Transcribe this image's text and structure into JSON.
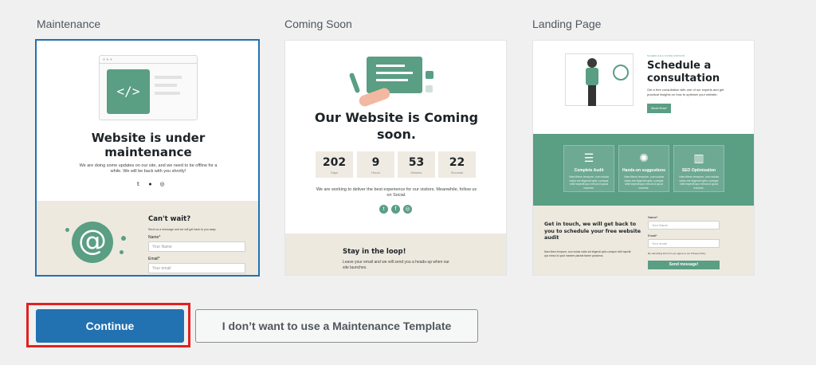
{
  "templates": [
    {
      "name": "Maintenance",
      "heading": "Website is under maintenance",
      "text": "We are doing some updates on our site, and we need to be offline for a while. We will be back with you shortly!",
      "form_title": "Can't wait?",
      "form_text": "Send us a message and we will get back to you asap.",
      "name_label": "Name*",
      "name_placeholder": "Your Name",
      "email_label": "Email*",
      "email_placeholder": "Your email"
    },
    {
      "name": "Coming Soon",
      "heading": "Our Website is Coming soon.",
      "countdown": [
        {
          "value": "202",
          "unit": "Days"
        },
        {
          "value": "9",
          "unit": "Hours"
        },
        {
          "value": "53",
          "unit": "Minutes"
        },
        {
          "value": "22",
          "unit": "Seconds"
        }
      ],
      "text": "We are working to deliver the best experience for our visitors. Meanwhile, follow us on Social.",
      "stay_title": "Stay in the loop!",
      "stay_text": "Leave your email and we will send you a heads-up when our site launches."
    },
    {
      "name": "Landing Page",
      "kicker": "SCHEDULE A CONSULTATION",
      "heading": "Schedule a consultation",
      "text": "Get a free consultation with one of our experts and get practical insights on how to optimize your website.",
      "button": "Book Now!",
      "features": [
        {
          "icon": "☰",
          "title": "Complete Audit",
          "desc": "Nam libero tempore, cum soluta nobis est eligendi optio cumque nihil impedit quo minus id quod maxime."
        },
        {
          "icon": "✺",
          "title": "Hands-on suggestions",
          "desc": "Nam libero tempore, cum soluta nobis est eligendi optio cumque nihil impedit quo minus id quod maxime."
        },
        {
          "icon": "▥",
          "title": "SEO Optimization",
          "desc": "Nam libero tempore, cum soluta nobis est eligendi optio cumque nihil impedit quo minus id quod maxime."
        }
      ],
      "contact_title": "Get in touch, we will get back to you to schedule your free website audit",
      "contact_text": "Nam libero tempore, cum soluta nobis est eligendi optio cumque nihil impedit quo minus id quod maxime placeat facere possimus.",
      "name_label": "Name*",
      "name_placeholder": "Your Name",
      "email_label": "Email*",
      "email_placeholder": "Your email",
      "consent": "By submitting this form you agree to our Privacy Policy",
      "send_button": "Send message!"
    }
  ],
  "buttons": {
    "continue": "Continue",
    "decline": "I don’t want to use a Maintenance Template"
  },
  "colors": {
    "accent_green": "#5a9e84",
    "primary_blue": "#2271b1",
    "highlight_red": "#e12121"
  }
}
